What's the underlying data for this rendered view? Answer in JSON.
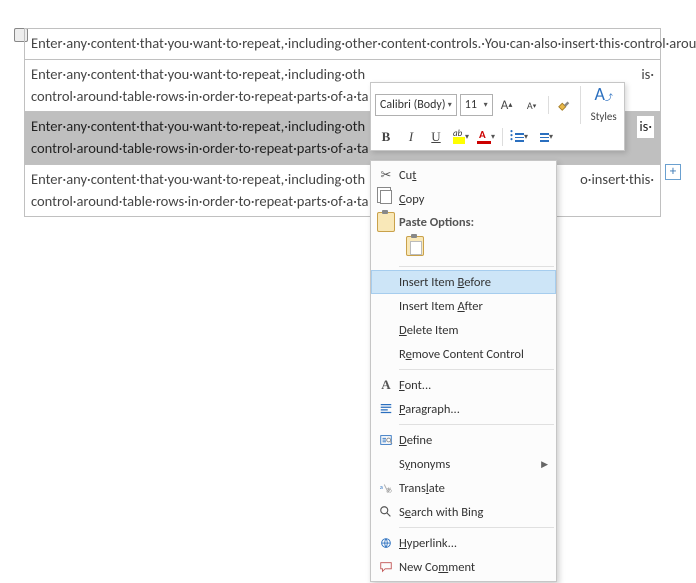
{
  "mini_toolbar": {
    "font_name": "Calibri (Body)",
    "font_size": "11",
    "styles_label": "Styles"
  },
  "doc": {
    "para": "Enter·any·content·that·you·want·to·repeat,·including·other·content·controls.·You·can·also·insert·this·control·around·table·rows·in·order·to·repeat·parts·of·a·table.¶",
    "para_trunc_r": "Enter·any·content·that·you·want·to·repeat,·including·oth",
    "para_trunc_r2": "control·around·table·rows·in·order·to·repeat·parts·of·a·ta",
    "tail_is": "is·",
    "tail_insert": "o·insert·this·"
  },
  "context_menu": {
    "cut": "Cut",
    "copy": "Copy",
    "paste_header": "Paste Options:",
    "insert_before": "Insert Item Before",
    "insert_after": "Insert Item After",
    "delete_item": "Delete Item",
    "remove_cc": "Remove Content Control",
    "font": "Font...",
    "paragraph": "Paragraph...",
    "define": "Define",
    "synonyms": "Synonyms",
    "translate": "Translate",
    "search_bing": "Search with Bing",
    "hyperlink": "Hyperlink...",
    "new_comment": "New Comment"
  }
}
